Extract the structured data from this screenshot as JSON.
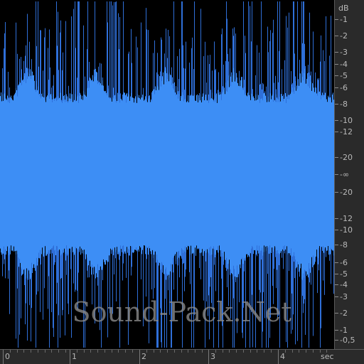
{
  "editor": {
    "watermark": "Sound-Pack.Net",
    "colors": {
      "background": "#000000",
      "waveform": "#3d8ef5",
      "waveform_peaks": "#2f6fd8",
      "ruler_background": "#2a2a2a",
      "ruler_text": "#b8b8b8"
    }
  },
  "db_ruler": {
    "unit": "dB",
    "labels": [
      "-1",
      "-2",
      "-3",
      "-4",
      "-5",
      "-6",
      "-8",
      "-10",
      "-12",
      "-20",
      "-∞",
      "-20",
      "-12",
      "-10",
      "-8",
      "-6",
      "-5",
      "-4",
      "-3",
      "-2",
      "-1",
      "-0,5"
    ]
  },
  "time_ruler": {
    "labels": [
      "0",
      "1",
      "2",
      "3",
      "4"
    ],
    "unit": "sec"
  }
}
